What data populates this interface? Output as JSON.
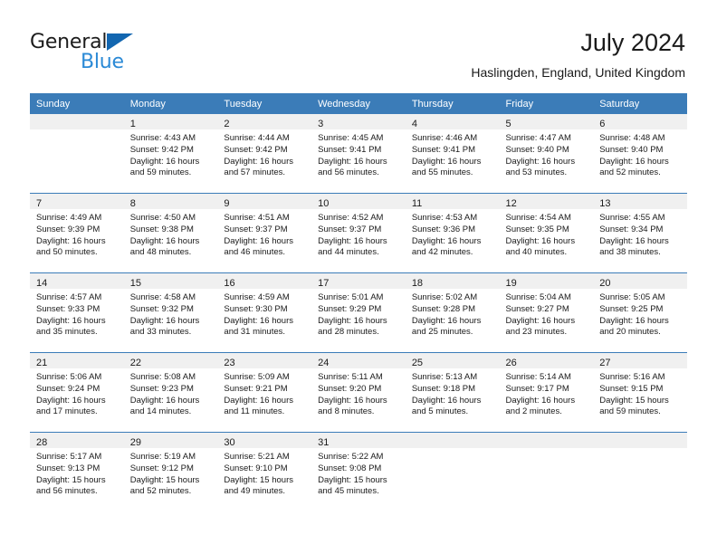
{
  "brand": {
    "name_top": "General",
    "name_bottom": "Blue",
    "accent_color": "#2b8ad6",
    "triangle_color": "#1266b0",
    "triangle_icon": "triangle-icon"
  },
  "header": {
    "title": "July 2024",
    "subtitle": "Haslingden, England, United Kingdom"
  },
  "theme": {
    "header_row_bg": "#3b7cb8",
    "header_row_text": "#ffffff",
    "daynum_band_bg": "#f0f0f0",
    "week_divider": "#3b7cb8",
    "body_text": "#1a1a1a"
  },
  "weekday_headers": [
    "Sunday",
    "Monday",
    "Tuesday",
    "Wednesday",
    "Thursday",
    "Friday",
    "Saturday"
  ],
  "weeks": [
    [
      {
        "day": "",
        "sunrise": "",
        "sunset": "",
        "daylight_line1": "",
        "daylight_line2": ""
      },
      {
        "day": "1",
        "sunrise": "Sunrise: 4:43 AM",
        "sunset": "Sunset: 9:42 PM",
        "daylight_line1": "Daylight: 16 hours",
        "daylight_line2": "and 59 minutes."
      },
      {
        "day": "2",
        "sunrise": "Sunrise: 4:44 AM",
        "sunset": "Sunset: 9:42 PM",
        "daylight_line1": "Daylight: 16 hours",
        "daylight_line2": "and 57 minutes."
      },
      {
        "day": "3",
        "sunrise": "Sunrise: 4:45 AM",
        "sunset": "Sunset: 9:41 PM",
        "daylight_line1": "Daylight: 16 hours",
        "daylight_line2": "and 56 minutes."
      },
      {
        "day": "4",
        "sunrise": "Sunrise: 4:46 AM",
        "sunset": "Sunset: 9:41 PM",
        "daylight_line1": "Daylight: 16 hours",
        "daylight_line2": "and 55 minutes."
      },
      {
        "day": "5",
        "sunrise": "Sunrise: 4:47 AM",
        "sunset": "Sunset: 9:40 PM",
        "daylight_line1": "Daylight: 16 hours",
        "daylight_line2": "and 53 minutes."
      },
      {
        "day": "6",
        "sunrise": "Sunrise: 4:48 AM",
        "sunset": "Sunset: 9:40 PM",
        "daylight_line1": "Daylight: 16 hours",
        "daylight_line2": "and 52 minutes."
      }
    ],
    [
      {
        "day": "7",
        "sunrise": "Sunrise: 4:49 AM",
        "sunset": "Sunset: 9:39 PM",
        "daylight_line1": "Daylight: 16 hours",
        "daylight_line2": "and 50 minutes."
      },
      {
        "day": "8",
        "sunrise": "Sunrise: 4:50 AM",
        "sunset": "Sunset: 9:38 PM",
        "daylight_line1": "Daylight: 16 hours",
        "daylight_line2": "and 48 minutes."
      },
      {
        "day": "9",
        "sunrise": "Sunrise: 4:51 AM",
        "sunset": "Sunset: 9:37 PM",
        "daylight_line1": "Daylight: 16 hours",
        "daylight_line2": "and 46 minutes."
      },
      {
        "day": "10",
        "sunrise": "Sunrise: 4:52 AM",
        "sunset": "Sunset: 9:37 PM",
        "daylight_line1": "Daylight: 16 hours",
        "daylight_line2": "and 44 minutes."
      },
      {
        "day": "11",
        "sunrise": "Sunrise: 4:53 AM",
        "sunset": "Sunset: 9:36 PM",
        "daylight_line1": "Daylight: 16 hours",
        "daylight_line2": "and 42 minutes."
      },
      {
        "day": "12",
        "sunrise": "Sunrise: 4:54 AM",
        "sunset": "Sunset: 9:35 PM",
        "daylight_line1": "Daylight: 16 hours",
        "daylight_line2": "and 40 minutes."
      },
      {
        "day": "13",
        "sunrise": "Sunrise: 4:55 AM",
        "sunset": "Sunset: 9:34 PM",
        "daylight_line1": "Daylight: 16 hours",
        "daylight_line2": "and 38 minutes."
      }
    ],
    [
      {
        "day": "14",
        "sunrise": "Sunrise: 4:57 AM",
        "sunset": "Sunset: 9:33 PM",
        "daylight_line1": "Daylight: 16 hours",
        "daylight_line2": "and 35 minutes."
      },
      {
        "day": "15",
        "sunrise": "Sunrise: 4:58 AM",
        "sunset": "Sunset: 9:32 PM",
        "daylight_line1": "Daylight: 16 hours",
        "daylight_line2": "and 33 minutes."
      },
      {
        "day": "16",
        "sunrise": "Sunrise: 4:59 AM",
        "sunset": "Sunset: 9:30 PM",
        "daylight_line1": "Daylight: 16 hours",
        "daylight_line2": "and 31 minutes."
      },
      {
        "day": "17",
        "sunrise": "Sunrise: 5:01 AM",
        "sunset": "Sunset: 9:29 PM",
        "daylight_line1": "Daylight: 16 hours",
        "daylight_line2": "and 28 minutes."
      },
      {
        "day": "18",
        "sunrise": "Sunrise: 5:02 AM",
        "sunset": "Sunset: 9:28 PM",
        "daylight_line1": "Daylight: 16 hours",
        "daylight_line2": "and 25 minutes."
      },
      {
        "day": "19",
        "sunrise": "Sunrise: 5:04 AM",
        "sunset": "Sunset: 9:27 PM",
        "daylight_line1": "Daylight: 16 hours",
        "daylight_line2": "and 23 minutes."
      },
      {
        "day": "20",
        "sunrise": "Sunrise: 5:05 AM",
        "sunset": "Sunset: 9:25 PM",
        "daylight_line1": "Daylight: 16 hours",
        "daylight_line2": "and 20 minutes."
      }
    ],
    [
      {
        "day": "21",
        "sunrise": "Sunrise: 5:06 AM",
        "sunset": "Sunset: 9:24 PM",
        "daylight_line1": "Daylight: 16 hours",
        "daylight_line2": "and 17 minutes."
      },
      {
        "day": "22",
        "sunrise": "Sunrise: 5:08 AM",
        "sunset": "Sunset: 9:23 PM",
        "daylight_line1": "Daylight: 16 hours",
        "daylight_line2": "and 14 minutes."
      },
      {
        "day": "23",
        "sunrise": "Sunrise: 5:09 AM",
        "sunset": "Sunset: 9:21 PM",
        "daylight_line1": "Daylight: 16 hours",
        "daylight_line2": "and 11 minutes."
      },
      {
        "day": "24",
        "sunrise": "Sunrise: 5:11 AM",
        "sunset": "Sunset: 9:20 PM",
        "daylight_line1": "Daylight: 16 hours",
        "daylight_line2": "and 8 minutes."
      },
      {
        "day": "25",
        "sunrise": "Sunrise: 5:13 AM",
        "sunset": "Sunset: 9:18 PM",
        "daylight_line1": "Daylight: 16 hours",
        "daylight_line2": "and 5 minutes."
      },
      {
        "day": "26",
        "sunrise": "Sunrise: 5:14 AM",
        "sunset": "Sunset: 9:17 PM",
        "daylight_line1": "Daylight: 16 hours",
        "daylight_line2": "and 2 minutes."
      },
      {
        "day": "27",
        "sunrise": "Sunrise: 5:16 AM",
        "sunset": "Sunset: 9:15 PM",
        "daylight_line1": "Daylight: 15 hours",
        "daylight_line2": "and 59 minutes."
      }
    ],
    [
      {
        "day": "28",
        "sunrise": "Sunrise: 5:17 AM",
        "sunset": "Sunset: 9:13 PM",
        "daylight_line1": "Daylight: 15 hours",
        "daylight_line2": "and 56 minutes."
      },
      {
        "day": "29",
        "sunrise": "Sunrise: 5:19 AM",
        "sunset": "Sunset: 9:12 PM",
        "daylight_line1": "Daylight: 15 hours",
        "daylight_line2": "and 52 minutes."
      },
      {
        "day": "30",
        "sunrise": "Sunrise: 5:21 AM",
        "sunset": "Sunset: 9:10 PM",
        "daylight_line1": "Daylight: 15 hours",
        "daylight_line2": "and 49 minutes."
      },
      {
        "day": "31",
        "sunrise": "Sunrise: 5:22 AM",
        "sunset": "Sunset: 9:08 PM",
        "daylight_line1": "Daylight: 15 hours",
        "daylight_line2": "and 45 minutes."
      },
      {
        "day": "",
        "sunrise": "",
        "sunset": "",
        "daylight_line1": "",
        "daylight_line2": ""
      },
      {
        "day": "",
        "sunrise": "",
        "sunset": "",
        "daylight_line1": "",
        "daylight_line2": ""
      },
      {
        "day": "",
        "sunrise": "",
        "sunset": "",
        "daylight_line1": "",
        "daylight_line2": ""
      }
    ]
  ]
}
